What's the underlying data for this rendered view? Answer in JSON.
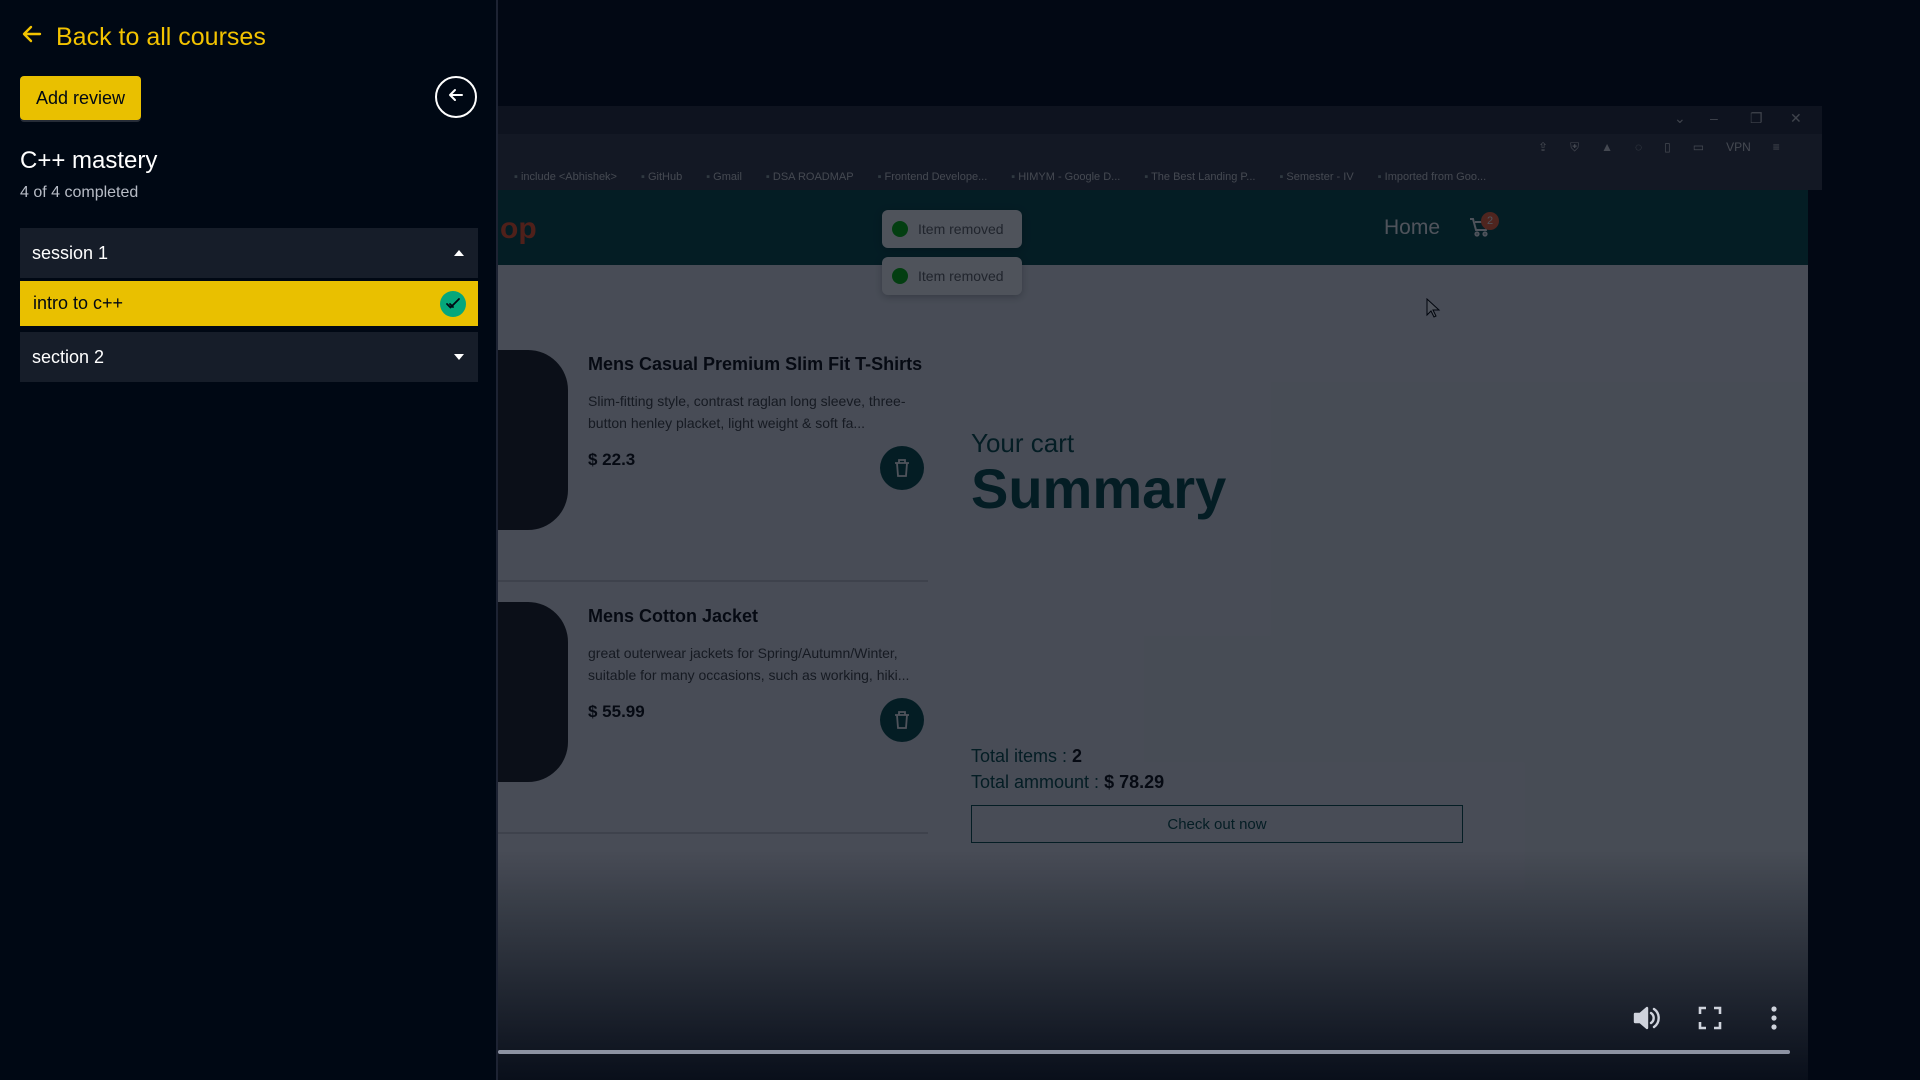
{
  "sidebar": {
    "back_label": "Back to all courses",
    "add_review_label": "Add review",
    "course_title": "C++ mastery",
    "progress_text": "4 of 4 completed",
    "sections": [
      {
        "title": "session 1",
        "expanded": true,
        "lectures": [
          {
            "title": "intro to c++",
            "completed": true
          }
        ]
      },
      {
        "title": "section 2",
        "expanded": false,
        "lectures": []
      }
    ]
  },
  "video": {
    "progress_fraction": 1.0,
    "browser": {
      "bookmarks": [
        "include <Abhishek>",
        "GitHub",
        "Gmail",
        "DSA ROADMAP",
        "Frontend Develope...",
        "HIMYM - Google D...",
        "The Best Landing P...",
        "Semester - IV",
        "Imported from Goo..."
      ],
      "vpn_label": "VPN"
    },
    "shop": {
      "logo_fragment": "op",
      "nav_home": "Home",
      "cart_count": "2",
      "toasts": [
        "Item removed",
        "Item removed"
      ],
      "items": [
        {
          "title": "Mens Casual Premium Slim Fit T-Shirts",
          "desc": "Slim-fitting style, contrast raglan long sleeve, three-button henley placket, light weight & soft fa...",
          "price": "$ 22.3"
        },
        {
          "title": "Mens Cotton Jacket",
          "desc": "great outerwear jackets for Spring/Autumn/Winter, suitable for many occasions, such as working, hiki...",
          "price": "$ 55.99"
        }
      ],
      "cart_label": "Your cart",
      "summary_label": "Summary",
      "total_items_label": "Total items :",
      "total_items_value": "2",
      "total_amount_label": "Total ammount :",
      "total_amount_value": "$ 78.29",
      "checkout_label": "Check out now"
    }
  },
  "colors": {
    "accent": "#e9c000",
    "background": "#000814",
    "section_bg": "#161d29",
    "check_green": "#05a77b"
  }
}
